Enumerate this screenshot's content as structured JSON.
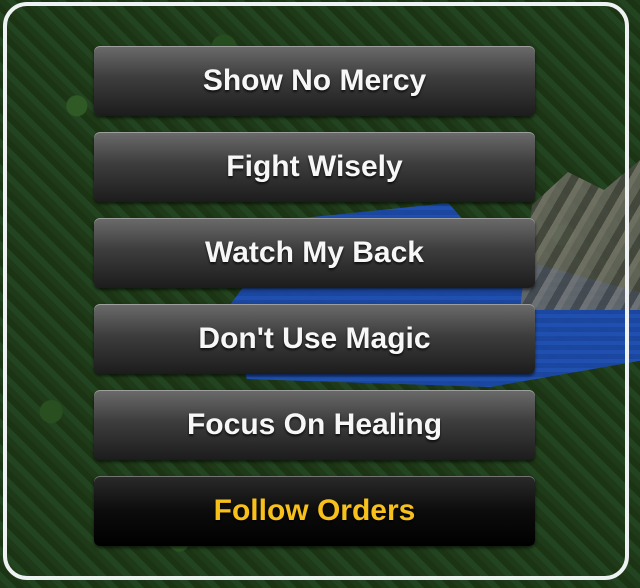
{
  "menu": {
    "items": [
      {
        "label": "Show No Mercy"
      },
      {
        "label": "Fight Wisely"
      },
      {
        "label": "Watch My Back"
      },
      {
        "label": "Don't Use Magic"
      },
      {
        "label": "Focus On Healing"
      },
      {
        "label": "Follow Orders"
      }
    ],
    "selected_index": 5,
    "selected_color": "#f7c01a",
    "text_color": "#f7f7f7"
  }
}
